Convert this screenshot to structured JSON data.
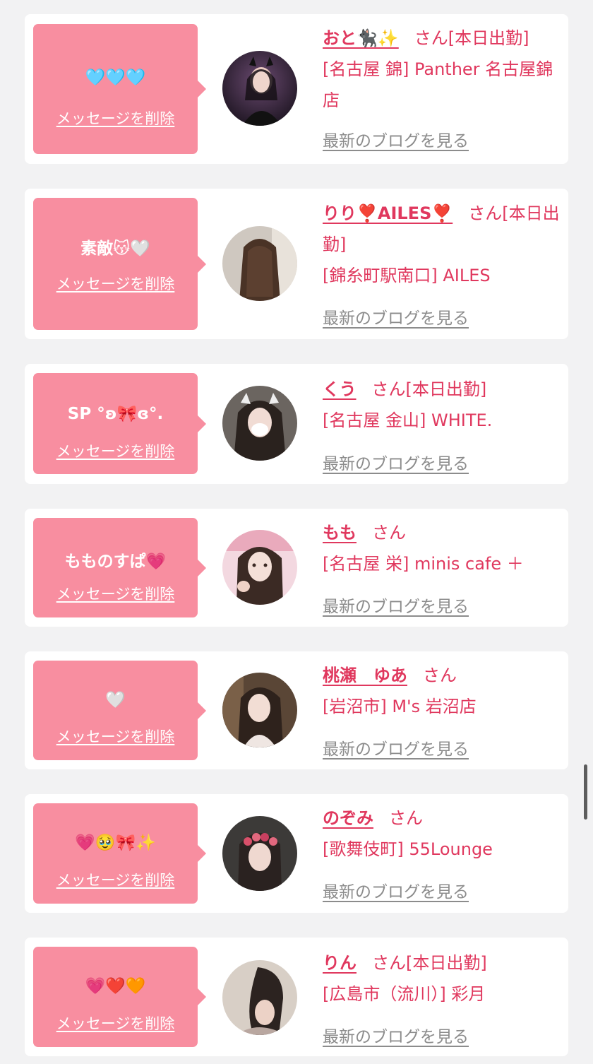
{
  "delete_label": "メッセージを削除",
  "blog_label": "最新のブログを見る",
  "suffix_san": "さん",
  "colors": {
    "background": "#f2f2f3",
    "bubble": "#f88ea0",
    "accent": "#e0385e",
    "link_gray": "#8c8c8c"
  },
  "entries": [
    {
      "message": "🩵🩵🩵",
      "name": "おと🐈‍⬛✨",
      "tag": "[本日出勤]",
      "shop": "[名古屋 錦] Panther 名古屋錦店",
      "avatar": "avatar-photo-girl-dark-purple"
    },
    {
      "message": "素敵😽🤍",
      "name": "りり❣️AILES❣️",
      "tag": "[本日出勤]",
      "shop": "[錦糸町駅南口] AILES",
      "avatar": "avatar-photo-brown-hair"
    },
    {
      "message": "SP °ʚ🎀ɞ°.",
      "name": "くう",
      "tag": "[本日出勤]",
      "shop": "[名古屋 金山] WHITE.",
      "avatar": "avatar-photo-girl-mask"
    },
    {
      "message": "もものすぱ💗",
      "name": "もも",
      "tag": "",
      "shop": "[名古屋 栄] minis cafe ＋",
      "avatar": "avatar-photo-girl-pink"
    },
    {
      "message": "🤍",
      "name": "桃瀬　ゆあ",
      "tag": "",
      "shop": "[岩沼市] M's 岩沼店",
      "avatar": "avatar-photo-girl-wood"
    },
    {
      "message": "💗🥹🎀✨",
      "name": "のぞみ",
      "tag": "",
      "shop": "[歌舞伎町] 55Lounge",
      "avatar": "avatar-photo-girl-flowers"
    },
    {
      "message": "💗❤️🧡",
      "name": "りん",
      "tag": "[本日出勤]",
      "shop": "[広島市（流川）] 彩月",
      "avatar": "avatar-photo-kimono"
    }
  ]
}
